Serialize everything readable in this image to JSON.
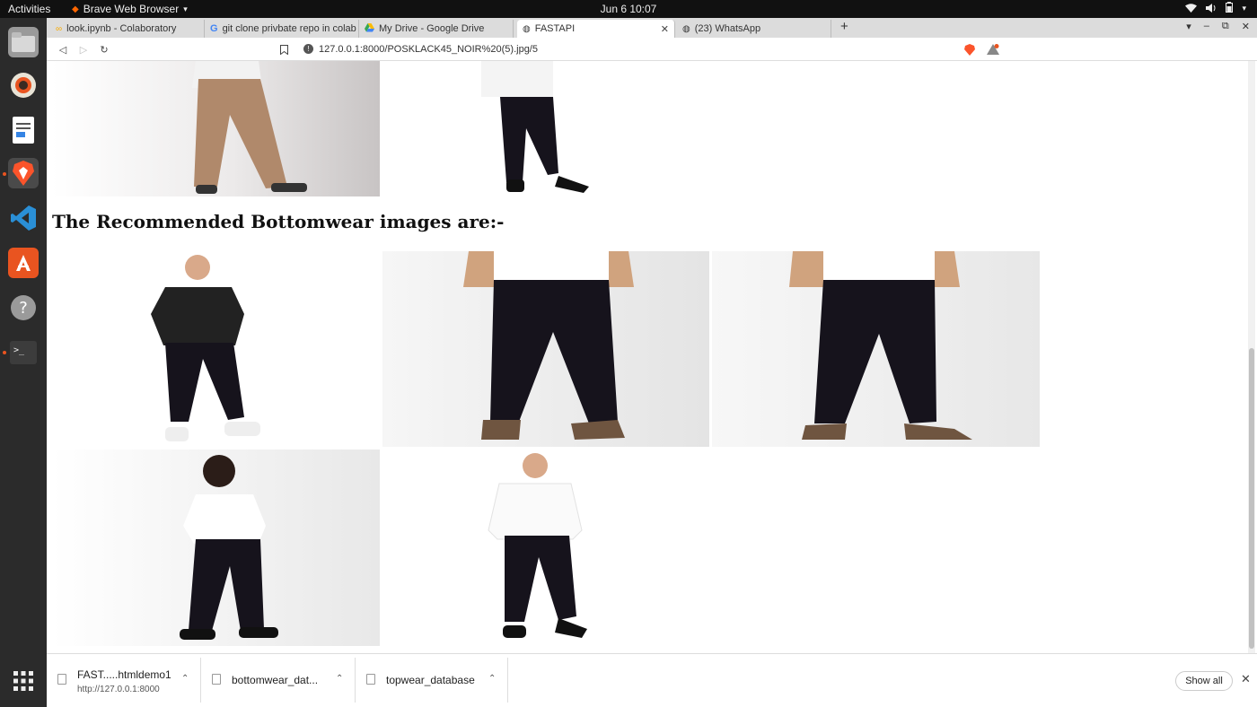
{
  "topbar": {
    "activities": "Activities",
    "app_name": "Brave Web Browser",
    "clock": "Jun 6  10:07"
  },
  "tabs": [
    {
      "label": "look.ipynb - Colaboratory",
      "icon": "colab-icon"
    },
    {
      "label": "git clone privbate repo in colab",
      "icon": "google-icon"
    },
    {
      "label": "My Drive - Google Drive",
      "icon": "drive-icon"
    },
    {
      "label": "FASTAPI",
      "icon": "globe-icon",
      "active": true
    },
    {
      "label": "(23) WhatsApp",
      "icon": "globe-icon"
    }
  ],
  "address": {
    "url": "127.0.0.1:8000/POSKLACK45_NOIR%20(5).jpg/5"
  },
  "page": {
    "heading": "The Recommended Bottomwear images are:-"
  },
  "downloads": [
    {
      "name": "FAST.....htmldemo1",
      "sub": "http://127.0.0.1:8000"
    },
    {
      "name": "bottomwear_dat...",
      "sub": ""
    },
    {
      "name": "topwear_database",
      "sub": ""
    }
  ],
  "shelf": {
    "show_all": "Show all",
    "close": "✕"
  },
  "colors": {
    "dock": "#2b2b2b",
    "accent": "#e95420",
    "pants": "#16131c",
    "shirt": "#f4f4f4"
  }
}
